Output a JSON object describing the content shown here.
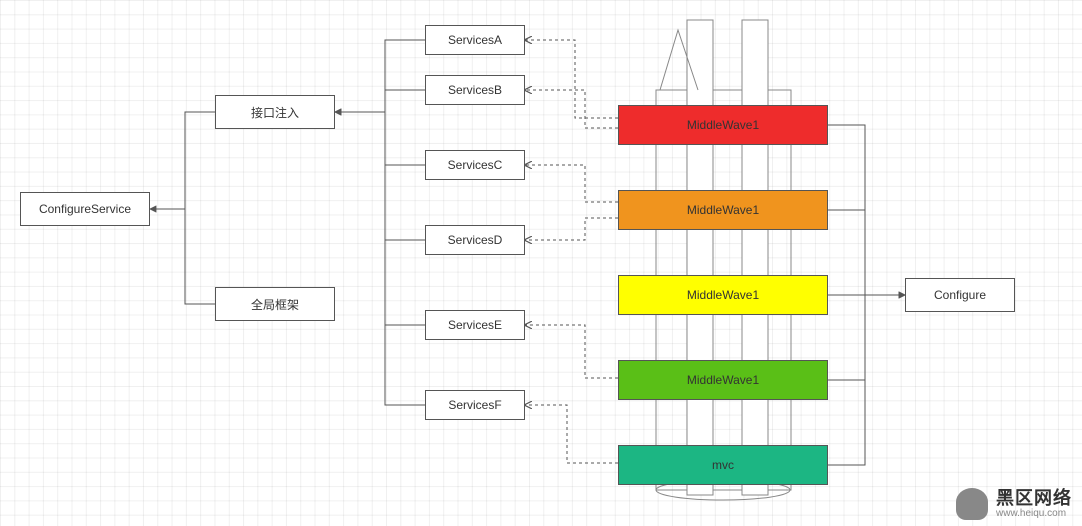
{
  "nodes": {
    "configureService": "ConfigureService",
    "interfaceInject": "接口注入",
    "globalFrame": "全局框架",
    "servicesA": "ServicesA",
    "servicesB": "ServicesB",
    "servicesC": "ServicesC",
    "servicesD": "ServicesD",
    "servicesE": "ServicesE",
    "servicesF": "ServicesF",
    "configure": "Configure"
  },
  "middlewares": {
    "m1": "MiddleWave1",
    "m2": "MiddleWave1",
    "m3": "MiddleWave1",
    "m4": "MiddleWave1",
    "m5": "mvc"
  },
  "colors": {
    "m1": "#ee2c2c",
    "m2": "#f0941e",
    "m3": "#ffff00",
    "m4": "#5abf17",
    "m5": "#1cb683"
  },
  "watermark": {
    "title": "黑区网络",
    "url": "www.heiqu.com"
  },
  "chart_data": {
    "type": "diagram",
    "title": "",
    "nodes": [
      {
        "id": "configureService",
        "label": "ConfigureService"
      },
      {
        "id": "interfaceInject",
        "label": "接口注入"
      },
      {
        "id": "globalFrame",
        "label": "全局框架"
      },
      {
        "id": "servicesA",
        "label": "ServicesA"
      },
      {
        "id": "servicesB",
        "label": "ServicesB"
      },
      {
        "id": "servicesC",
        "label": "ServicesC"
      },
      {
        "id": "servicesD",
        "label": "ServicesD"
      },
      {
        "id": "servicesE",
        "label": "ServicesE"
      },
      {
        "id": "servicesF",
        "label": "ServicesF"
      },
      {
        "id": "middleWave1_1",
        "label": "MiddleWave1",
        "color": "#ee2c2c"
      },
      {
        "id": "middleWave1_2",
        "label": "MiddleWave1",
        "color": "#f0941e"
      },
      {
        "id": "middleWave1_3",
        "label": "MiddleWave1",
        "color": "#ffff00"
      },
      {
        "id": "middleWave1_4",
        "label": "MiddleWave1",
        "color": "#5abf17"
      },
      {
        "id": "mvc",
        "label": "mvc",
        "color": "#1cb683"
      },
      {
        "id": "configure",
        "label": "Configure"
      }
    ],
    "edges_solid": [
      [
        "interfaceInject",
        "configureService"
      ],
      [
        "globalFrame",
        "configureService"
      ],
      [
        "servicesA",
        "interfaceInject"
      ],
      [
        "servicesB",
        "interfaceInject"
      ],
      [
        "servicesC",
        "interfaceInject"
      ],
      [
        "servicesD",
        "interfaceInject"
      ],
      [
        "servicesE",
        "interfaceInject"
      ],
      [
        "servicesF",
        "interfaceInject"
      ],
      [
        "middleWave1_1",
        "configure"
      ],
      [
        "middleWave1_2",
        "configure"
      ],
      [
        "middleWave1_3",
        "configure"
      ],
      [
        "middleWave1_4",
        "configure"
      ],
      [
        "mvc",
        "configure"
      ]
    ],
    "edges_dashed": [
      [
        "middleWave1_1",
        "servicesA"
      ],
      [
        "middleWave1_1",
        "servicesB"
      ],
      [
        "middleWave1_2",
        "servicesC"
      ],
      [
        "middleWave1_2",
        "servicesD"
      ],
      [
        "middleWave1_4",
        "servicesE"
      ],
      [
        "mvc",
        "servicesF"
      ]
    ]
  }
}
